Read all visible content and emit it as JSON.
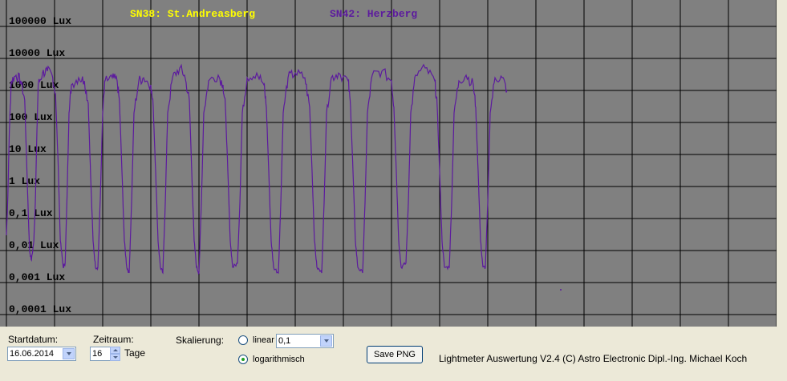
{
  "chart_data": {
    "type": "line",
    "y_scale": "log",
    "ylim": [
      0.0001,
      100000
    ],
    "y_tick_labels": [
      "100000 Lux",
      "10000 Lux",
      "1000 Lux",
      "100 Lux",
      "10 Lux",
      "1 Lux",
      "0,1 Lux",
      "0,01 Lux",
      "0,001 Lux",
      "0,0001 Lux"
    ],
    "x_start": "16.06.2014",
    "x_days": 16,
    "grid": true,
    "plot_background": "#808080",
    "series": [
      {
        "name": "SN38: St.Andreasberg",
        "color": "#ffff00",
        "points": []
      },
      {
        "name": "SN42: Herzberg",
        "color": "#5c1a9e",
        "x_unit": "days since 16.06.2014 00:00",
        "points": [
          [
            0.0,
            0.03
          ],
          [
            0.03,
            0.5
          ],
          [
            0.06,
            50
          ],
          [
            0.1,
            2000
          ],
          [
            0.2,
            3000
          ],
          [
            0.3,
            2000
          ],
          [
            0.38,
            500
          ],
          [
            0.43,
            2
          ],
          [
            0.48,
            0.01
          ],
          [
            0.52,
            0.005
          ],
          [
            0.57,
            0.02
          ],
          [
            0.6,
            0.3
          ],
          [
            0.63,
            30
          ],
          [
            0.66,
            1500
          ],
          [
            0.75,
            3500
          ],
          [
            0.85,
            4000
          ],
          [
            0.95,
            3000
          ],
          [
            1.02,
            800
          ],
          [
            1.08,
            3
          ],
          [
            1.12,
            0.02
          ],
          [
            1.18,
            0.003
          ],
          [
            1.22,
            0.004
          ],
          [
            1.26,
            0.5
          ],
          [
            1.3,
            200
          ],
          [
            1.35,
            1500
          ],
          [
            1.5,
            2500
          ],
          [
            1.62,
            2000
          ],
          [
            1.7,
            400
          ],
          [
            1.75,
            2
          ],
          [
            1.8,
            0.02
          ],
          [
            1.85,
            0.003
          ],
          [
            1.9,
            0.003
          ],
          [
            1.95,
            0.4
          ],
          [
            2.0,
            200
          ],
          [
            2.05,
            2000
          ],
          [
            2.2,
            2500
          ],
          [
            2.3,
            2000
          ],
          [
            2.35,
            400
          ],
          [
            2.4,
            3
          ],
          [
            2.45,
            0.02
          ],
          [
            2.5,
            0.003
          ],
          [
            2.55,
            0.002
          ],
          [
            2.6,
            0.3
          ],
          [
            2.65,
            200
          ],
          [
            2.75,
            2000
          ],
          [
            2.85,
            2500
          ],
          [
            3.0,
            1500
          ],
          [
            3.05,
            300
          ],
          [
            3.1,
            3
          ],
          [
            3.15,
            0.02
          ],
          [
            3.2,
            0.003
          ],
          [
            3.25,
            0.002
          ],
          [
            3.3,
            0.3
          ],
          [
            3.35,
            200
          ],
          [
            3.45,
            2500
          ],
          [
            3.6,
            5000
          ],
          [
            3.7,
            3000
          ],
          [
            3.8,
            500
          ],
          [
            3.85,
            3
          ],
          [
            3.9,
            0.02
          ],
          [
            3.95,
            0.003
          ],
          [
            4.0,
            0.002
          ],
          [
            4.05,
            0.3
          ],
          [
            4.1,
            200
          ],
          [
            4.2,
            2000
          ],
          [
            4.4,
            3000
          ],
          [
            4.5,
            1500
          ],
          [
            4.55,
            300
          ],
          [
            4.6,
            3
          ],
          [
            4.65,
            0.02
          ],
          [
            4.7,
            0.003
          ],
          [
            4.8,
            0.004
          ],
          [
            4.85,
            0.3
          ],
          [
            4.9,
            200
          ],
          [
            5.0,
            2500
          ],
          [
            5.2,
            3500
          ],
          [
            5.35,
            1500
          ],
          [
            5.4,
            300
          ],
          [
            5.45,
            3
          ],
          [
            5.5,
            0.02
          ],
          [
            5.55,
            0.003
          ],
          [
            5.65,
            0.002
          ],
          [
            5.7,
            0.3
          ],
          [
            5.75,
            200
          ],
          [
            5.85,
            2500
          ],
          [
            6.0,
            3500
          ],
          [
            6.2,
            2500
          ],
          [
            6.3,
            300
          ],
          [
            6.35,
            3
          ],
          [
            6.4,
            0.02
          ],
          [
            6.45,
            0.003
          ],
          [
            6.55,
            0.002
          ],
          [
            6.6,
            0.3
          ],
          [
            6.65,
            200
          ],
          [
            6.75,
            2500
          ],
          [
            6.9,
            3500
          ],
          [
            7.1,
            2000
          ],
          [
            7.15,
            300
          ],
          [
            7.2,
            3
          ],
          [
            7.25,
            0.02
          ],
          [
            7.3,
            0.003
          ],
          [
            7.4,
            0.002
          ],
          [
            7.45,
            0.3
          ],
          [
            7.5,
            200
          ],
          [
            7.6,
            3000
          ],
          [
            7.8,
            4000
          ],
          [
            8.0,
            2000
          ],
          [
            8.05,
            300
          ],
          [
            8.1,
            3
          ],
          [
            8.15,
            0.02
          ],
          [
            8.2,
            0.003
          ],
          [
            8.3,
            0.004
          ],
          [
            8.35,
            0.3
          ],
          [
            8.4,
            200
          ],
          [
            8.5,
            3000
          ],
          [
            8.7,
            5000
          ],
          [
            8.9,
            2000
          ],
          [
            8.95,
            300
          ],
          [
            9.0,
            3
          ],
          [
            9.05,
            0.02
          ],
          [
            9.1,
            0.003
          ],
          [
            9.2,
            0.003
          ],
          [
            9.25,
            0.3
          ],
          [
            9.3,
            200
          ],
          [
            9.4,
            2000
          ],
          [
            9.55,
            3000
          ],
          [
            9.7,
            1500
          ],
          [
            9.75,
            300
          ],
          [
            9.8,
            3
          ],
          [
            9.85,
            0.02
          ],
          [
            9.9,
            0.003
          ],
          [
            9.95,
            0.003
          ],
          [
            10.0,
            0.3
          ],
          [
            10.05,
            200
          ],
          [
            10.15,
            2500
          ],
          [
            10.3,
            2500
          ],
          [
            10.4,
            1000
          ]
        ]
      }
    ]
  },
  "controls": {
    "startdatum_label": "Startdatum:",
    "startdatum_value": "16.06.2014",
    "zeitraum_label": "Zeitraum:",
    "zeitraum_value": "16",
    "zeitraum_unit": "Tage",
    "skalierung_label": "Skalierung:",
    "linear_label": "linear",
    "linear_value": "0,1",
    "log_label": "logarithmisch",
    "scale_selected": "logarithmisch",
    "save_label": "Save PNG",
    "footer": "Lightmeter Auswertung V2.4  (C) Astro Electronic Dipl.-Ing. Michael Koch"
  }
}
